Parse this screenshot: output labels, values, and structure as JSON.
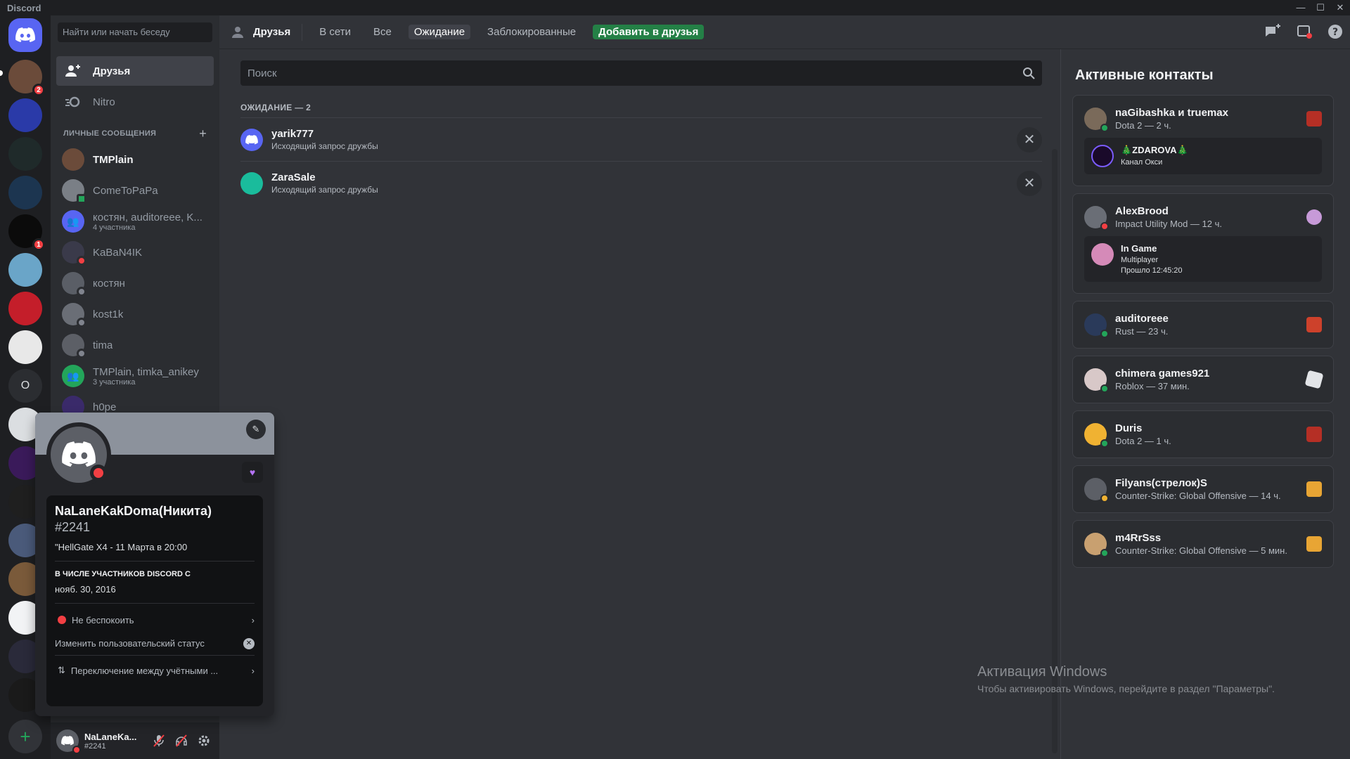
{
  "window": {
    "app_name": "Discord",
    "minimize": "—",
    "maximize": "☐",
    "close": "✕"
  },
  "sidebar": {
    "search_placeholder": "Найти или начать беседу",
    "nav": [
      {
        "label": "Друзья"
      },
      {
        "label": "Nitro"
      }
    ],
    "dm_header": "ЛИЧНЫЕ СООБЩЕНИЯ",
    "dms": [
      {
        "name": "TMPlain",
        "sub": ""
      },
      {
        "name": "ComeToPaPa",
        "sub": ""
      },
      {
        "name": "костян, auditoreee, K...",
        "sub": "4 участника"
      },
      {
        "name": "KaBaN4IK",
        "sub": ""
      },
      {
        "name": "костян",
        "sub": ""
      },
      {
        "name": "kost1k",
        "sub": ""
      },
      {
        "name": "tima",
        "sub": ""
      },
      {
        "name": "TMPlain, timka_anikey",
        "sub": "3 участника"
      },
      {
        "name": "h0pe",
        "sub": ""
      }
    ],
    "guild_badges": [
      "2",
      "1"
    ]
  },
  "userbar": {
    "name": "NaLaneKa...",
    "tag": "#2241"
  },
  "topbar": {
    "title": "Друзья",
    "tabs": [
      "В сети",
      "Все",
      "Ожидание",
      "Заблокированные"
    ],
    "add_button": "Добавить в друзья"
  },
  "friends": {
    "search_placeholder": "Поиск",
    "pending_header": "ОЖИДАНИЕ — 2",
    "pending": [
      {
        "name": "yarik777",
        "sub": "Исходящий запрос дружбы"
      },
      {
        "name": "ZaraSale",
        "sub": "Исходящий запрос дружбы"
      }
    ]
  },
  "activity": {
    "title": "Активные контакты",
    "cards": [
      {
        "name": "naGibashka и truemax",
        "sub": "Dota 2 — 2 ч.",
        "inner": {
          "t1": "🎄ZDAROVA🎄",
          "t2": "Канал Окси"
        }
      },
      {
        "name": "AlexBrood",
        "sub": "Impact Utility Mod — 12 ч.",
        "inner": {
          "t1": "In Game",
          "t2": "Multiplayer",
          "t3": "Прошло 12:45:20"
        }
      },
      {
        "name": "auditoreee",
        "sub": "Rust — 23 ч."
      },
      {
        "name": "chimera games921",
        "sub": "Roblox — 37 мин."
      },
      {
        "name": "Duris",
        "sub": "Dota 2 — 1 ч."
      },
      {
        "name": "Filyans(стрелок)S",
        "sub": "Counter-Strike: Global Offensive — 14 ч."
      },
      {
        "name": "m4RrSss",
        "sub": "Counter-Strike: Global Offensive — 5 мин."
      }
    ]
  },
  "profile_popout": {
    "username": "NaLaneKakDoma(Никита)",
    "discriminator": "#2241",
    "custom_status": "\"HellGate X4 - 11 Марта в 20:00",
    "member_since_label": "В ЧИСЛЕ УЧАСТНИКОВ DISCORD С",
    "member_since": "нояб. 30, 2016",
    "status": "Не беспокоить",
    "edit_status": "Изменить пользовательский статус",
    "switch_accounts": "Переключение между учётными ..."
  },
  "watermark": {
    "line1": "Активация Windows",
    "line2": "Чтобы активировать Windows, перейдите в раздел \"Параметры\"."
  },
  "colors": {
    "accent": "#5865f2",
    "online": "#23a55a",
    "dnd": "#f23f43",
    "idle": "#f0b232",
    "add_green": "#248046"
  }
}
